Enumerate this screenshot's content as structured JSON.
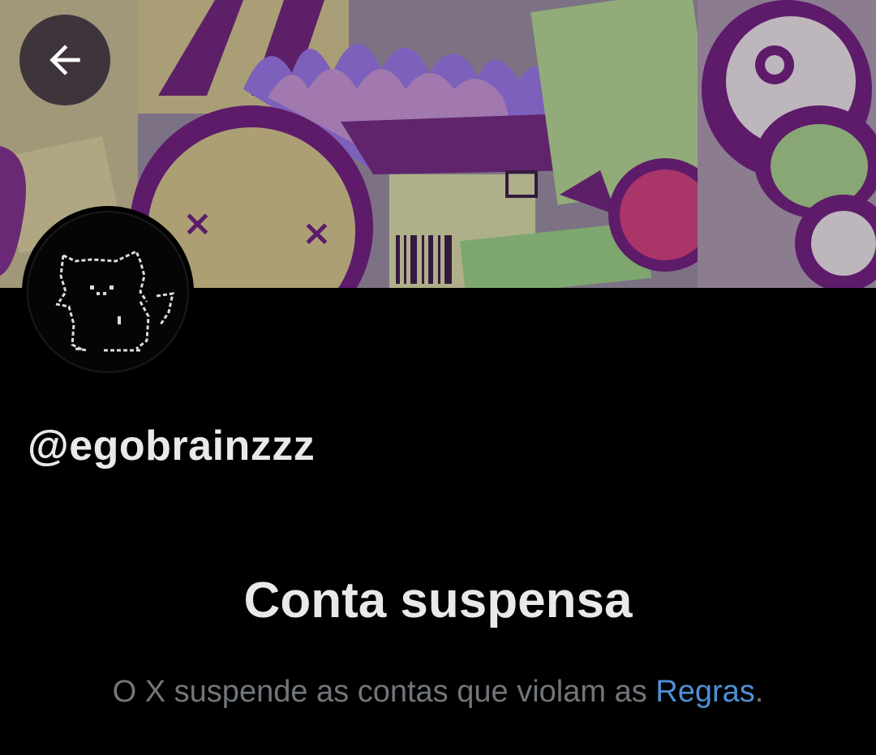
{
  "header": {
    "back_icon": "arrow-left-icon"
  },
  "profile": {
    "handle": "@egobrainzzz",
    "avatar_icon": "pixel-cat-avatar"
  },
  "notice": {
    "title": "Conta suspensa",
    "description_prefix": "O X suspende as contas que violam as ",
    "rules_link": "Regras",
    "description_suffix": "."
  },
  "colors": {
    "background": "#000000",
    "text": "#e7e9ea",
    "muted": "#71767b",
    "link": "#4f8fd6"
  }
}
